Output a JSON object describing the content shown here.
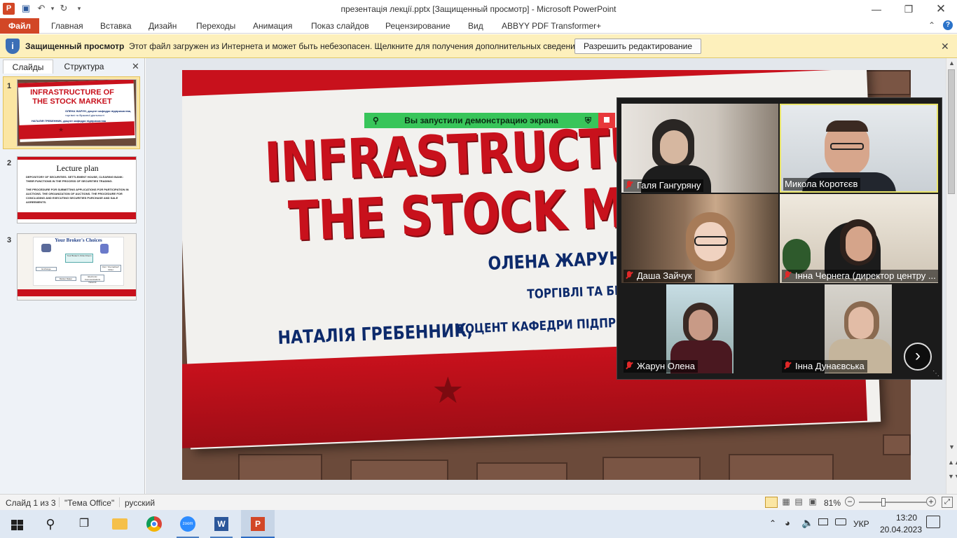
{
  "window": {
    "title": "презентація лекції.pptx [Защищенный просмотр]  -  Microsoft PowerPoint"
  },
  "ribbon": {
    "file": "Файл",
    "tabs": [
      "Главная",
      "Вставка",
      "Дизайн",
      "Переходы",
      "Анимация",
      "Показ слайдов",
      "Рецензирование",
      "Вид",
      "ABBYY PDF Transformer+"
    ]
  },
  "protected_view": {
    "title": "Защищенный просмотр",
    "message": "Этот файл загружен из Интернета и может быть небезопасен. Щелкните для получения дополнительных сведений.",
    "button": "Разрешить редактирование"
  },
  "left_panel": {
    "tabs": [
      "Слайды",
      "Структура"
    ],
    "slides": [
      {
        "num": "1",
        "title": "INFRASTRUCTURE OF THE STOCK MARKET",
        "sub1": "ОЛЕНА ЖАРУН, доцент кафедри підприємства,",
        "sub2": "торгівлі та біржової діяльності",
        "sub3": "НАТАЛІЯ ГРЕБЕННИК, доцент кафедри підприємства"
      },
      {
        "num": "2",
        "title": "Lecture plan",
        "b1": "DEPOSITORY OF SECURITIES. SETTLEMENT HOUSE, CLEARING BANK: THEIR FUNCTIONS IN THE PROCESS OF SECURITIES TRADING.",
        "b2": "THE PROCEDURE FOR SUBMITTING APPLICATIONS FOR PARTICIPATION IN AUCTIONS. THE ORGANIZATION OF AUCTIONS. THE PROCEDURE FOR CONCLUDING AND EXECUTING SECURITIES PURCHASE AND SALE AGREEMENTS."
      },
      {
        "num": "3",
        "title": "Your Broker's Choices",
        "center": "Your Broker's Order Room",
        "nodes": [
          "Exchange",
          "Market Maker",
          "Electronic Communications Network",
          "Own \"Internalized\" Order"
        ]
      }
    ]
  },
  "slide": {
    "title_line1": "INFRASTRUCTU",
    "title_line2": "THE STOCK MA",
    "author1": "ОЛЕНА ЖАРУН, Д",
    "dept1": "ТОРГІВЛІ ТА БІР",
    "author2": "НАТАЛІЯ ГРЕБЕННИК,",
    "dept2": "ДОЦЕНТ КАФЕДРИ ПІДПРИЄМ"
  },
  "screenshare": {
    "label": "Вы запустили демонстрацию экрана"
  },
  "zoom": {
    "participants": [
      {
        "name": "Галя Гангуряну",
        "muted": true
      },
      {
        "name": "Микола Коротєєв",
        "muted": false,
        "active": true
      },
      {
        "name": "Даша Зайчук",
        "muted": true
      },
      {
        "name": "Інна Чернега (директор центру ...",
        "muted": true
      },
      {
        "name": "Жарун Олена",
        "muted": true
      },
      {
        "name": "Інна Дунаєвська",
        "muted": true
      }
    ]
  },
  "status": {
    "slide_info": "Слайд 1 из 3",
    "theme": "\"Тема Office\"",
    "language": "русский",
    "zoom": "81%"
  },
  "taskbar": {
    "language": "УКР",
    "time": "13:20",
    "date": "20.04.2023"
  },
  "colors": {
    "accent": "#d24726",
    "slide_red": "#c8111c",
    "slide_navy": "#0d2a6b",
    "zoom_active": "#e9e46a"
  }
}
